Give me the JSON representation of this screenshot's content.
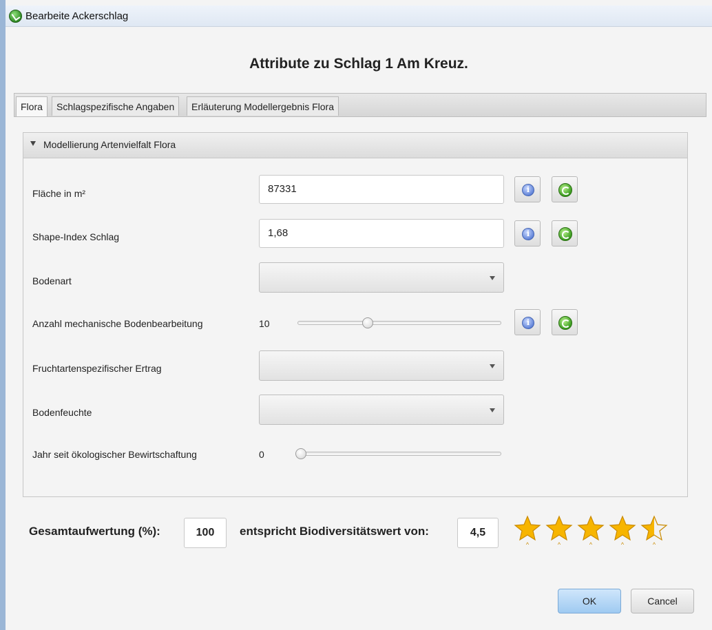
{
  "window": {
    "title": "Bearbeite Ackerschlag",
    "icon": "app-icon"
  },
  "heading": "Attribute zu Schlag 1 Am Kreuz.",
  "tabs": [
    {
      "label": "Flora",
      "active": true
    },
    {
      "label": "Schlagspezifische Angaben",
      "active": false
    },
    {
      "label": "Erläuterung Modellergebnis Flora",
      "active": false
    }
  ],
  "panel": {
    "title": "Modellierung Artenvielfalt Flora",
    "rows": {
      "flaeche": {
        "label": "Fläche in m²",
        "value": "87331"
      },
      "shape": {
        "label": "Shape-Index Schlag",
        "value": "1,68"
      },
      "bodenart": {
        "label": "Bodenart",
        "value": ""
      },
      "anzahl": {
        "label": "Anzahl mechanische Bodenbearbeitung",
        "value": "10",
        "slider_fraction": 0.34
      },
      "ertrag": {
        "label": "Fruchtartenspezifischer Ertrag",
        "value": ""
      },
      "feuchte": {
        "label": "Bodenfeuchte",
        "value": ""
      },
      "jahr": {
        "label": "Jahr seit ökologischer Bewirtschaftung",
        "value": "0",
        "slider_fraction": 0.0
      }
    }
  },
  "summary": {
    "total_label": "Gesamtaufwertung (%):",
    "total_value": "100",
    "bio_label": "entspricht Biodiversitätswert von:",
    "bio_value": "4,5",
    "rating": 4.5,
    "rating_max": 5,
    "star_color": "#f7b500"
  },
  "buttons": {
    "ok": "OK",
    "cancel": "Cancel"
  },
  "icons": {
    "info": "info-icon",
    "refresh": "refresh-icon",
    "star": "star-icon"
  }
}
